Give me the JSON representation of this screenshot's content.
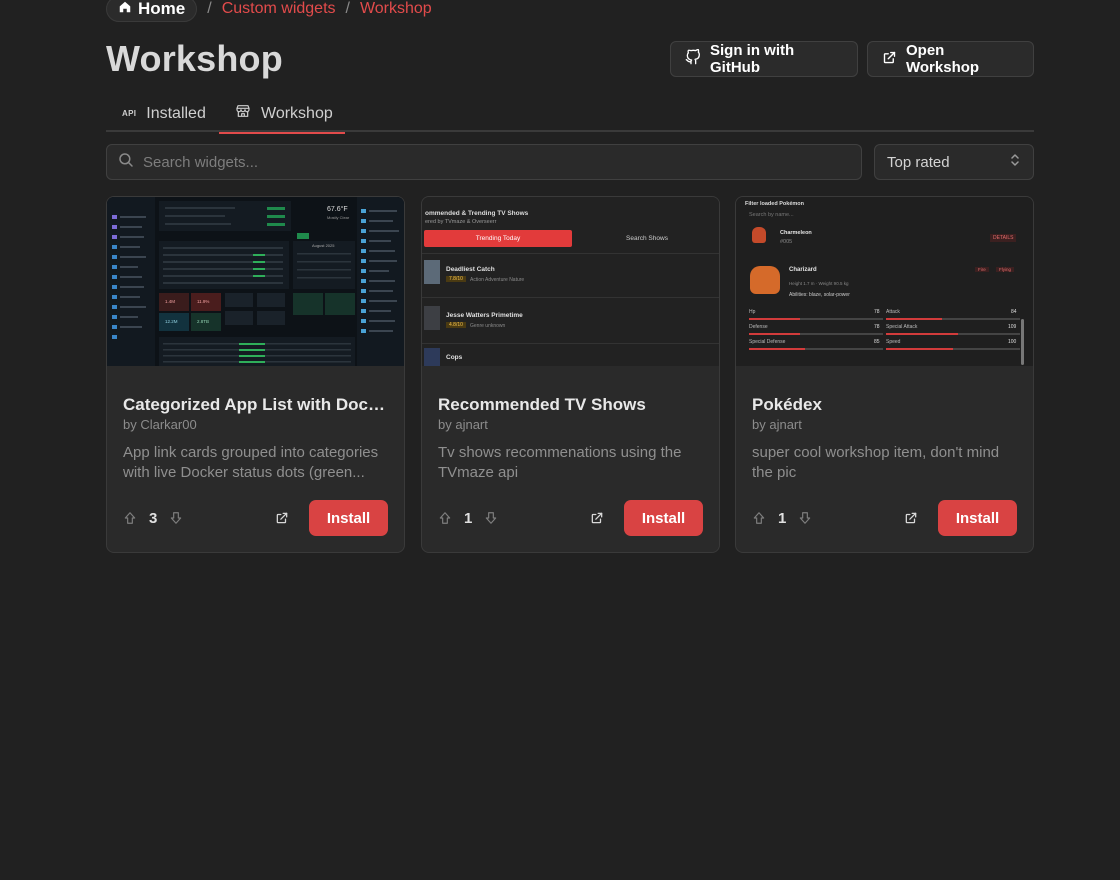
{
  "breadcrumb": {
    "home": "Home",
    "items": [
      "Custom widgets",
      "Workshop"
    ]
  },
  "page": {
    "title": "Workshop"
  },
  "header_buttons": {
    "github": "Sign in with GitHub",
    "open": "Open Workshop"
  },
  "tabs": [
    {
      "label": "Installed",
      "icon": "api-icon",
      "icon_text": "API"
    },
    {
      "label": "Workshop",
      "icon": "store-icon"
    }
  ],
  "search": {
    "placeholder": "Search widgets...",
    "value": ""
  },
  "sort": {
    "selected": "Top rated"
  },
  "colors": {
    "accent": "#e24b4b",
    "background": "#212121",
    "card": "#2a2a2a"
  },
  "cards": [
    {
      "title": "Categorized App List with Docker Status",
      "author": "by Clarkar00",
      "description": "App link cards grouped into categories with live Docker status dots (green...",
      "votes": "3",
      "install_label": "Install",
      "thumb": {
        "temp": "67.6°F",
        "weather": "Mostly Clear",
        "calendar_month": "August 2025",
        "stat_a": "1.4M",
        "stat_b": "11.9%",
        "stat_c": "12.2M",
        "stat_d": "2.8TB"
      }
    },
    {
      "title": "Recommended TV Shows",
      "author": "by ajnart",
      "description": "Tv shows recommenations using the TVmaze api",
      "votes": "1",
      "install_label": "Install",
      "thumb": {
        "heading": "ommended & Trending TV Shows",
        "subheading": "ered by TVmaze & Overseerr",
        "tab_active": "Trending Today",
        "tab_other": "Search Shows",
        "shows": [
          {
            "name": "Deadliest Catch",
            "rating": "7.8/10",
            "genres": "Action   Adventure   Nature"
          },
          {
            "name": "Jesse Watters Primetime",
            "rating": "4.8/10",
            "genres": "Genre unknown"
          },
          {
            "name": "Cops"
          }
        ]
      }
    },
    {
      "title": "Pokédex",
      "author": "by ajnart",
      "description": "super cool workshop item, don't mind the pic",
      "votes": "1",
      "install_label": "Install",
      "thumb": {
        "filter_label": "Filter loaded Pokémon",
        "search_placeholder": "Search by name...",
        "first": {
          "name": "Charmeleon",
          "id": "#005",
          "badge": "DETAILS"
        },
        "second": {
          "name": "Charizard",
          "meta": "Height 1.7 m · Weight 90.5 kg",
          "types": [
            "Fire",
            "Flying"
          ],
          "abilities": "Abilities: blaze, solar-power"
        },
        "stats": [
          {
            "label": "Hp",
            "value": "78"
          },
          {
            "label": "Attack",
            "value": "84"
          },
          {
            "label": "Defense",
            "value": "78"
          },
          {
            "label": "Special Attack",
            "value": "109"
          },
          {
            "label": "Special Defense",
            "value": "85"
          },
          {
            "label": "Speed",
            "value": "100"
          }
        ]
      }
    }
  ]
}
